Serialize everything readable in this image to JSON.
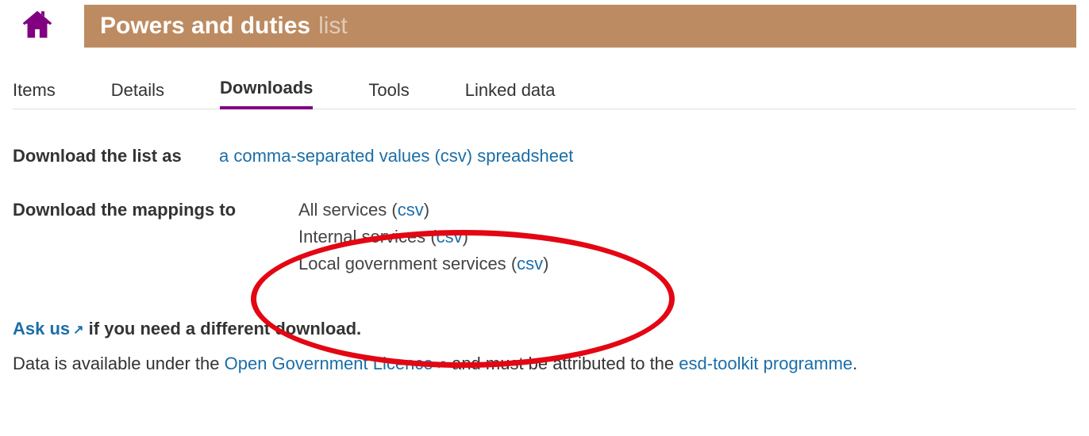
{
  "header": {
    "title": "Powers and duties",
    "subtitle": "list"
  },
  "tabs": [
    {
      "label": "Items",
      "active": false
    },
    {
      "label": "Details",
      "active": false
    },
    {
      "label": "Downloads",
      "active": true
    },
    {
      "label": "Tools",
      "active": false
    },
    {
      "label": "Linked data",
      "active": false
    }
  ],
  "list_download": {
    "label": "Download the list as",
    "link_text": "a comma-separated values (csv) spreadsheet"
  },
  "mappings_download": {
    "label": "Download the mappings to",
    "items": [
      {
        "name": "All services",
        "fmt": "csv"
      },
      {
        "name": "Internal services",
        "fmt": "csv"
      },
      {
        "name": "Local government services",
        "fmt": "csv"
      }
    ]
  },
  "ask": {
    "link": "Ask us",
    "rest": " if you need a different download."
  },
  "attribution": {
    "pre": "Data is available under the ",
    "ogl": "Open Government Licence",
    "mid": " and must be attributed to the ",
    "esd": "esd-toolkit programme",
    "post": "."
  },
  "colors": {
    "accent": "#800080",
    "header_bg": "#bd8b61",
    "link": "#1b6ea8",
    "annotation": "#e30613"
  }
}
